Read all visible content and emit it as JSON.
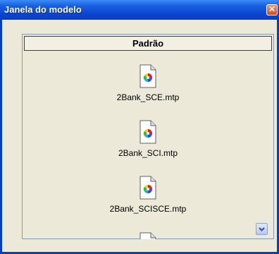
{
  "window": {
    "title": "Janela do modelo",
    "close_glyph": "✕"
  },
  "panel": {
    "header": "Padrão",
    "files": [
      {
        "name": "2Bank_SCE.mtp",
        "icon": "color-wheel-document-icon"
      },
      {
        "name": "2Bank_SCI.mtp",
        "icon": "color-wheel-document-icon"
      },
      {
        "name": "2Bank_SCISCE.mtp",
        "icon": "color-wheel-document-icon"
      }
    ],
    "scroll_icon": "chevron-down-icon"
  },
  "colors": {
    "titlebar": "#0b46d2",
    "close": "#d84a20",
    "face": "#ece9d8"
  }
}
